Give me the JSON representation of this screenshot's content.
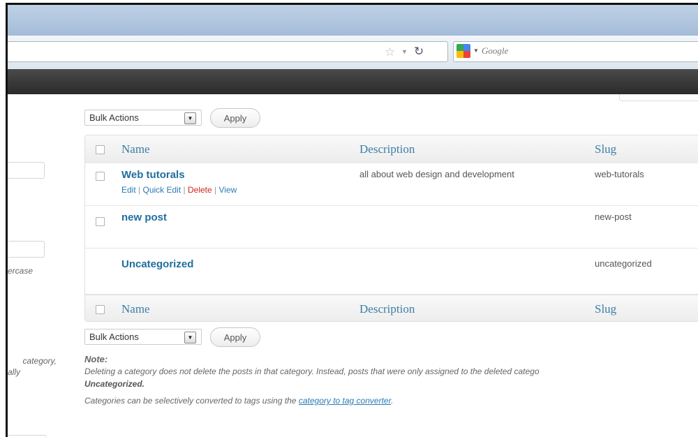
{
  "browser": {
    "search_placeholder": "Google"
  },
  "left_panel": {
    "hint_fragment": "ercase",
    "category_fragment_1": "category,",
    "category_fragment_2": "ally"
  },
  "bulk_actions_top": {
    "select_value": "Bulk Actions",
    "apply_label": "Apply"
  },
  "bulk_actions_bottom": {
    "select_value": "Bulk Actions",
    "apply_label": "Apply"
  },
  "table": {
    "columns": [
      "Name",
      "Description",
      "Slug"
    ],
    "rows": [
      {
        "name": "Web tutorals",
        "description": "all about web design and development",
        "slug": "web-tutorals",
        "actions": {
          "edit": "Edit",
          "quick_edit": "Quick Edit",
          "delete": "Delete",
          "view": "View",
          "separator": "|"
        }
      },
      {
        "name": "new post",
        "description": "",
        "slug": "new-post"
      },
      {
        "name": "Uncategorized",
        "description": "",
        "slug": "uncategorized"
      }
    ]
  },
  "notes": {
    "title": "Note:",
    "line1": "Deleting a category does not delete the posts in that category. Instead, posts that were only assigned to the deleted catego",
    "line2": "Uncategorized.",
    "line3_prefix": "Categories can be selectively converted to tags using the ",
    "line3_link": "category to tag converter",
    "line3_suffix": "."
  },
  "colors": {
    "link": "#1f6e9e",
    "delete": "#d32222",
    "admin_bar": "#2b2b2b",
    "title_bar": "#a4bbd8"
  }
}
